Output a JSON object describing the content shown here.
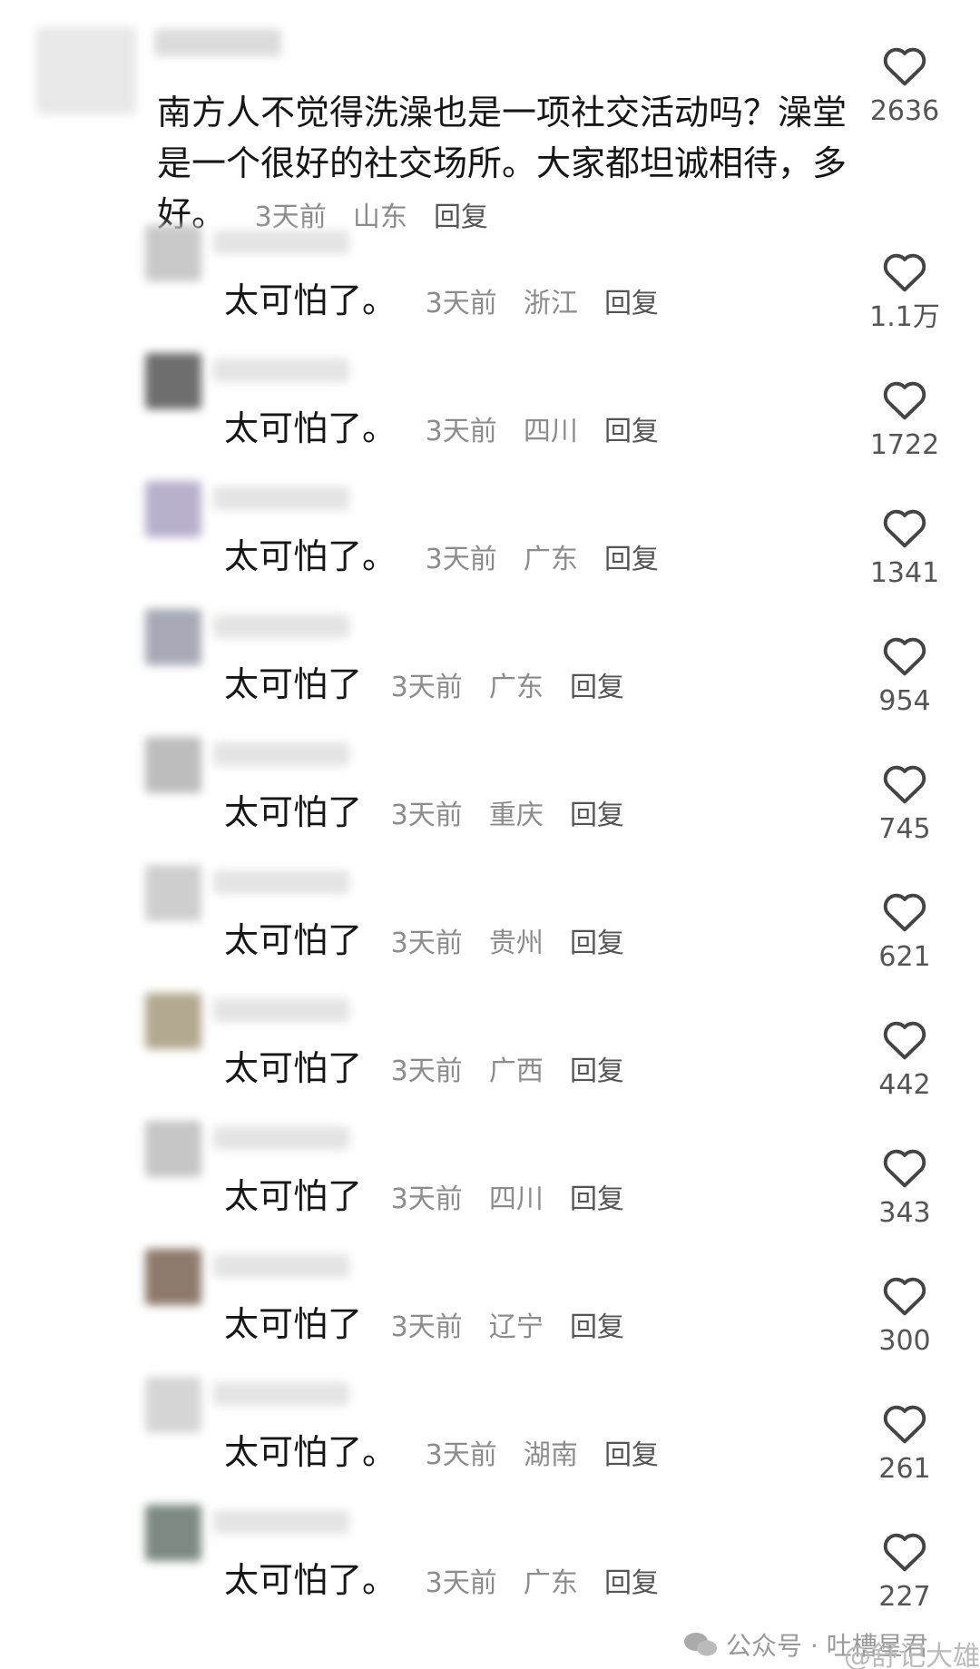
{
  "top_comment": {
    "text": "南方人不觉得洗澡也是一项社交活动吗？澡堂是一个很好的社交场所。大家都坦诚相待，多好。",
    "time": "3天前",
    "location": "山东",
    "reply_label": "回复",
    "likes": "2636"
  },
  "replies": [
    {
      "text": "太可怕了。",
      "time": "3天前",
      "location": "浙江",
      "reply_label": "回复",
      "likes": "1.1万"
    },
    {
      "text": "太可怕了。",
      "time": "3天前",
      "location": "四川",
      "reply_label": "回复",
      "likes": "1722"
    },
    {
      "text": "太可怕了。",
      "time": "3天前",
      "location": "广东",
      "reply_label": "回复",
      "likes": "1341"
    },
    {
      "text": "太可怕了",
      "time": "3天前",
      "location": "广东",
      "reply_label": "回复",
      "likes": "954"
    },
    {
      "text": "太可怕了",
      "time": "3天前",
      "location": "重庆",
      "reply_label": "回复",
      "likes": "745"
    },
    {
      "text": "太可怕了",
      "time": "3天前",
      "location": "贵州",
      "reply_label": "回复",
      "likes": "621"
    },
    {
      "text": "太可怕了",
      "time": "3天前",
      "location": "广西",
      "reply_label": "回复",
      "likes": "442"
    },
    {
      "text": "太可怕了",
      "time": "3天前",
      "location": "四川",
      "reply_label": "回复",
      "likes": "343"
    },
    {
      "text": "太可怕了",
      "time": "3天前",
      "location": "辽宁",
      "reply_label": "回复",
      "likes": "300"
    },
    {
      "text": "太可怕了。",
      "time": "3天前",
      "location": "湖南",
      "reply_label": "回复",
      "likes": "261"
    },
    {
      "text": "太可怕了。",
      "time": "3天前",
      "location": "广东",
      "reply_label": "回复",
      "likes": "227"
    }
  ],
  "watermark": {
    "text": "公众号 · 吐槽星君",
    "overlay_text": "@舒记大雄"
  },
  "icons": {
    "like": "heart-outline-icon",
    "watermark": "wechat-icon"
  }
}
